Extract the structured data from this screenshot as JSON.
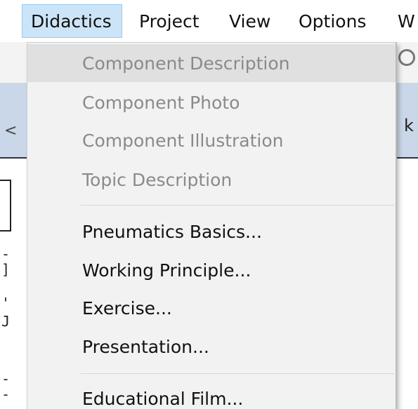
{
  "menubar": {
    "items": [
      {
        "label": "Didactics",
        "active": true
      },
      {
        "label": "Project"
      },
      {
        "label": "View"
      },
      {
        "label": "Options"
      },
      {
        "label": "W"
      }
    ]
  },
  "dropdown": {
    "items": [
      {
        "label": "Component Description",
        "enabled": false
      },
      {
        "label": "Component Photo",
        "enabled": false
      },
      {
        "label": "Component Illustration",
        "enabled": false
      },
      {
        "label": "Topic Description",
        "enabled": false
      },
      {
        "label": "Pneumatics Basics...",
        "enabled": true
      },
      {
        "label": "Working Principle...",
        "enabled": true
      },
      {
        "label": "Exercise...",
        "enabled": true
      },
      {
        "label": "Presentation...",
        "enabled": true
      },
      {
        "label": "Educational Film...",
        "enabled": true
      }
    ]
  },
  "background": {
    "right_fragment": "k",
    "left_fragment": "<"
  },
  "colors": {
    "active_menu_bg": "#cce4f7",
    "dropdown_bg": "#f2f2f2",
    "disabled_text": "#8a8a8a",
    "hover_bg": "#e0e0e0"
  },
  "icons": {
    "background_toolbar": "magnifier-icon"
  }
}
